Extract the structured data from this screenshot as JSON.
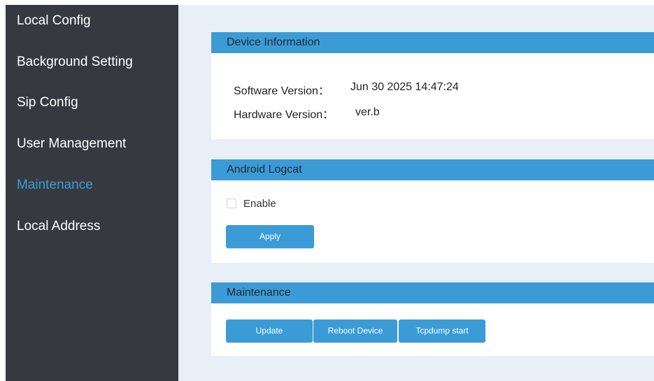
{
  "sidebar": {
    "items": [
      {
        "label": "Local Config"
      },
      {
        "label": "Background Setting"
      },
      {
        "label": "Sip Config"
      },
      {
        "label": "User Management"
      },
      {
        "label": "Maintenance",
        "active": true
      },
      {
        "label": "Local Address"
      }
    ]
  },
  "device_info": {
    "title": "Device Information",
    "software_label": "Software Version：",
    "software_value": "Jun 30 2025 14:47:24",
    "hardware_label": "Hardware Version：",
    "hardware_value": "ver.b"
  },
  "logcat": {
    "title": "Android Logcat",
    "enable_label": "Enable",
    "enabled": false,
    "apply_label": "Apply"
  },
  "maintenance": {
    "title": "Maintenance",
    "update_label": "Update",
    "reboot_label": "Reboot Device",
    "tcpdump_label": "Tcpdump start"
  },
  "colors": {
    "accent": "#3b9bd6",
    "sidebar_bg": "#363a40",
    "content_bg": "#e9eff7"
  }
}
